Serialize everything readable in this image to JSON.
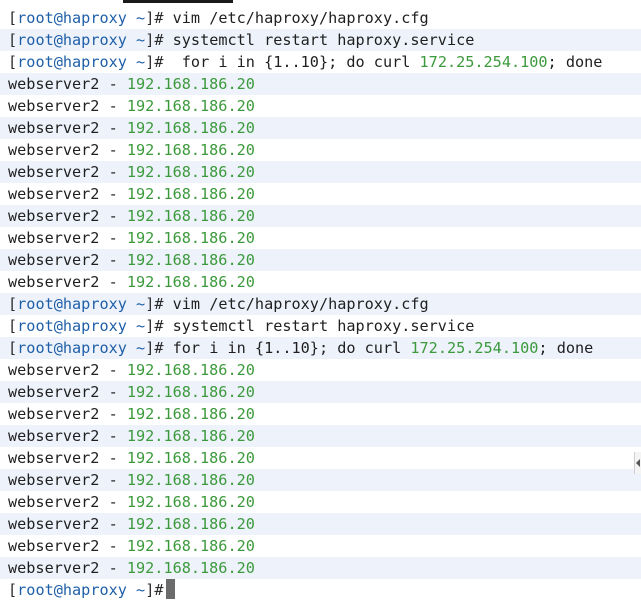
{
  "prompt": {
    "open": "[",
    "user": "root",
    "at": "@",
    "host": "haproxy",
    "space_tilde": " ~",
    "close": "]#"
  },
  "commands": {
    "c1": " vim /etc/haproxy/haproxy.cfg",
    "c2": " systemctl restart haproxy.service",
    "c3_pre": "  for i in {1..10}; do curl ",
    "c3_ip": "172.25.254.100",
    "c3_post": "; done",
    "c4": " vim /etc/haproxy/haproxy.cfg",
    "c5": " systemctl restart haproxy.service",
    "c6_pre": " for i in {1..10}; do curl ",
    "c6_ip": "172.25.254.100",
    "c6_post": "; done"
  },
  "output": {
    "name": "webserver2",
    "sep": " - ",
    "ip": "192.168.186.20"
  },
  "colors": {
    "prompt_blue": "#1f5fa8",
    "ip_green": "#3c9a3c",
    "row_stripe": "#edf2fb"
  }
}
